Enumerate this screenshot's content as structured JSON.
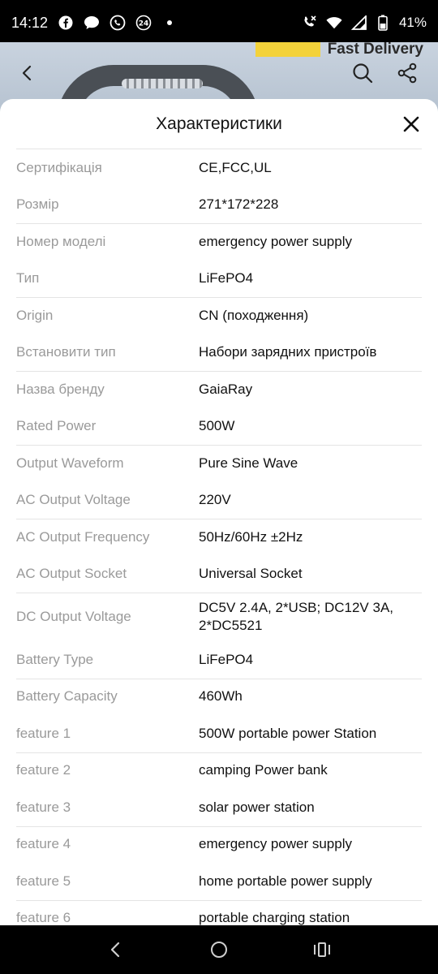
{
  "status": {
    "time": "14:12",
    "battery_percent": "41%",
    "left_icons": [
      "facebook-icon",
      "chat-icon",
      "viber-icon",
      "24-icon",
      "dot-icon"
    ],
    "right_icons": [
      "call-icon",
      "wifi-icon",
      "signal-icon",
      "battery-icon"
    ]
  },
  "background": {
    "banner_text": "Fast Delivery"
  },
  "sheet": {
    "title": "Характеристики",
    "close_icon": "close-icon",
    "specs": [
      {
        "label": "Сертифікація",
        "value": "CE,FCC,UL"
      },
      {
        "label": "Розмір",
        "value": "271*172*228"
      },
      {
        "label": "Номер моделі",
        "value": "emergency power supply"
      },
      {
        "label": "Тип",
        "value": "LiFePO4"
      },
      {
        "label": "Origin",
        "value": "CN (походження)"
      },
      {
        "label": "Встановити тип",
        "value": "Набори зарядних пристроїв"
      },
      {
        "label": "Назва бренду",
        "value": "GaiaRay"
      },
      {
        "label": "Rated Power",
        "value": "500W"
      },
      {
        "label": "Output Waveform",
        "value": "Pure Sine Wave"
      },
      {
        "label": "AC Output Voltage",
        "value": "220V"
      },
      {
        "label": "AC Output Frequency",
        "value": "50Hz/60Hz ±2Hz"
      },
      {
        "label": "AC Output Socket",
        "value": "Universal Socket"
      },
      {
        "label": "DC Output Voltage",
        "value": "DC5V 2.4A, 2*USB; DC12V 3A, 2*DC5521"
      },
      {
        "label": "Battery Type",
        "value": "LiFePO4"
      },
      {
        "label": "Battery Capacity",
        "value": "460Wh"
      },
      {
        "label": "feature 1",
        "value": "500W  portable power Station"
      },
      {
        "label": "feature 2",
        "value": "camping Power bank"
      },
      {
        "label": "feature 3",
        "value": "solar power station"
      },
      {
        "label": "feature 4",
        "value": "emergency power supply"
      },
      {
        "label": "feature 5",
        "value": "home portable power supply"
      },
      {
        "label": "feature 6",
        "value": "portable charging station"
      }
    ]
  },
  "navbar": {
    "icons": [
      "back-icon",
      "home-icon",
      "recents-icon"
    ]
  }
}
